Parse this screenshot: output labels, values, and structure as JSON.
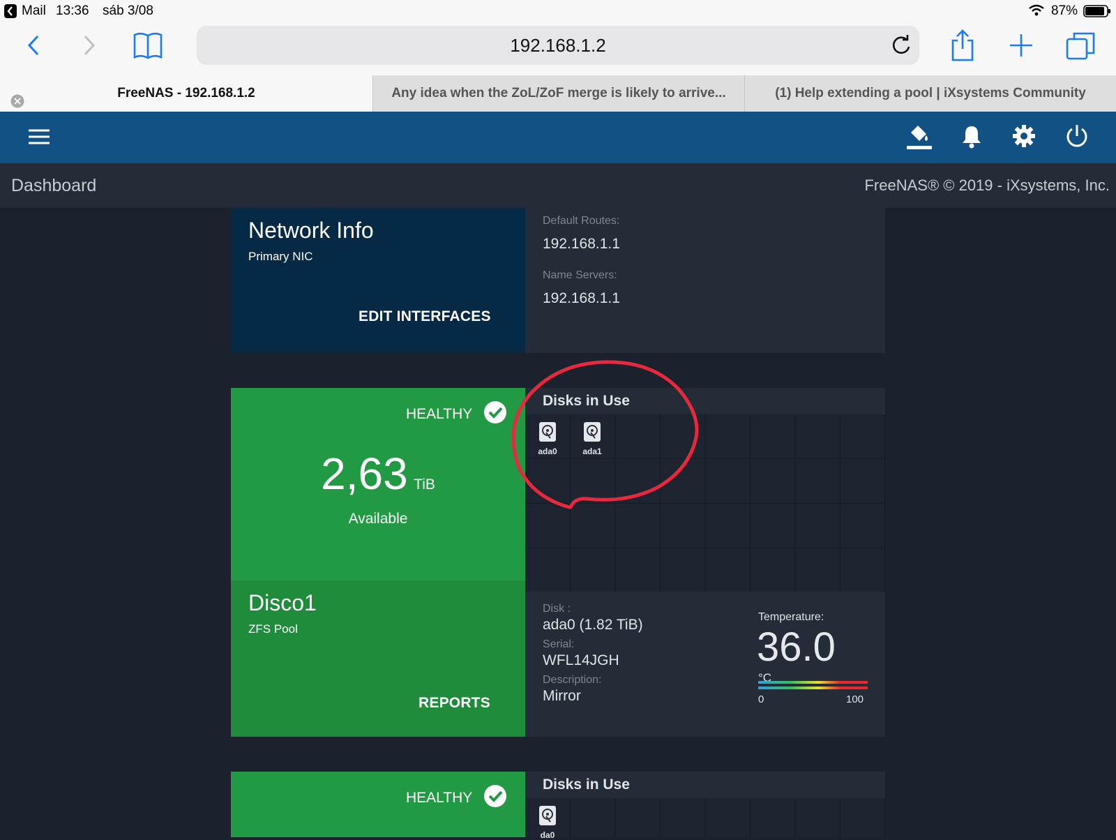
{
  "status_bar": {
    "back_app": "Mail",
    "time": "13:36",
    "date": "sáb 3/08",
    "battery": "87%"
  },
  "browser": {
    "url": "192.168.1.2",
    "tabs": [
      {
        "label": "FreeNAS - 192.168.1.2",
        "active": true
      },
      {
        "label": "Any idea when the ZoL/ZoF merge is likely to arrive..."
      },
      {
        "label": "(1) Help extending a pool | iXsystems Community"
      }
    ]
  },
  "app": {
    "page_title": "Dashboard",
    "copyright": "FreeNAS® © 2019 - iXsystems, Inc.",
    "header_icons": [
      "theme-bucket-icon",
      "bell-icon",
      "gear-icon",
      "power-icon"
    ]
  },
  "network": {
    "title": "Network Info",
    "subtitle": "Primary NIC",
    "button": "EDIT INTERFACES",
    "routes_label": "Default Routes:",
    "routes_value": "192.168.1.1",
    "ns_label": "Name Servers:",
    "ns_value": "192.168.1.1"
  },
  "pool1": {
    "status": "HEALTHY",
    "available_value": "2,63",
    "available_unit": "TiB",
    "available_label": "Available",
    "name": "Disco1",
    "type": "ZFS Pool",
    "button": "REPORTS",
    "disks_title": "Disks in Use",
    "disks": [
      "ada0",
      "ada1"
    ],
    "disk_label": "Disk :",
    "disk_value": "ada0 (1.82 TiB)",
    "serial_label": "Serial:",
    "serial_value": "WFL14JGH",
    "desc_label": "Description:",
    "desc_value": "Mirror",
    "temp_label": "Temperature:",
    "temp_value": "36.0",
    "temp_unit": "°C",
    "scale_min": "0",
    "scale_max": "100"
  },
  "pool2": {
    "status": "HEALTHY",
    "disks_title": "Disks in Use",
    "disks": [
      "da0"
    ]
  },
  "colors": {
    "app_header": "#115184",
    "healthy_green": "#219a43",
    "healthy_green_dark": "#1f8c3c",
    "network_blue": "#062945",
    "annotation_red": "#e8283c"
  }
}
